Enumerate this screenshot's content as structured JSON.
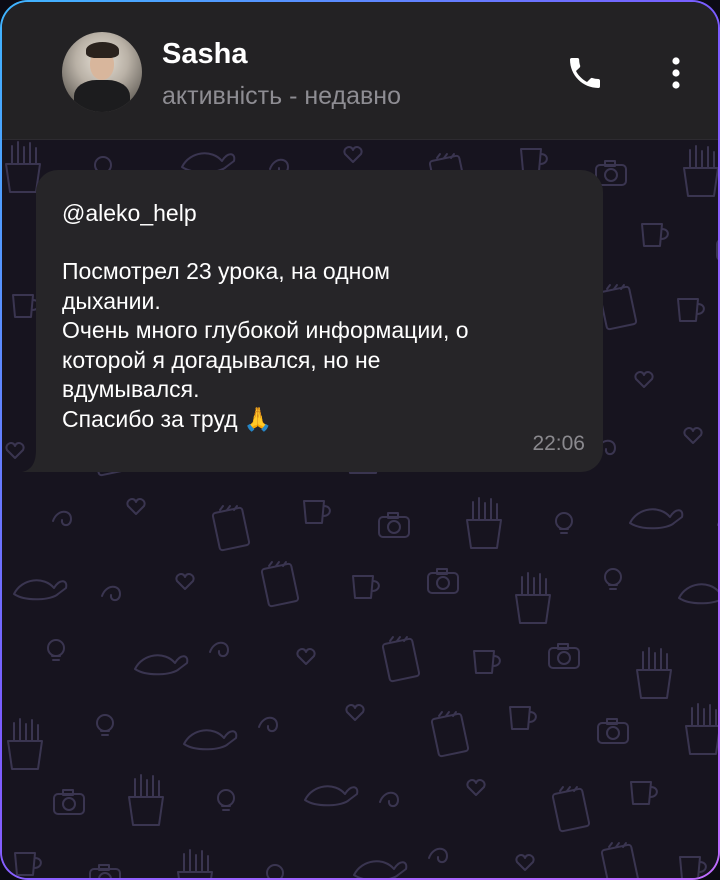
{
  "header": {
    "contact_name": "Sasha",
    "status": "активність - недавно",
    "avatar_icon": "user-avatar",
    "call_icon": "phone-icon",
    "more_icon": "more-vertical-icon"
  },
  "message": {
    "mention": "@aleko_help",
    "lines": [
      "Посмотрел 23 урока, на одном",
      "дыхании.",
      "Очень много глубокой информации, о",
      "которой я догадывался, но не",
      "вдумывался.",
      "Спасибо за труд 🙏"
    ],
    "time": "22:06"
  },
  "colors": {
    "header_bg": "#232224",
    "bubble_bg": "#262528",
    "wallpaper_bg": "#17141f",
    "doodle_stroke": "#3a3550",
    "frame_gradient_start": "#3fb6ff",
    "frame_gradient_end": "#c06cff"
  }
}
